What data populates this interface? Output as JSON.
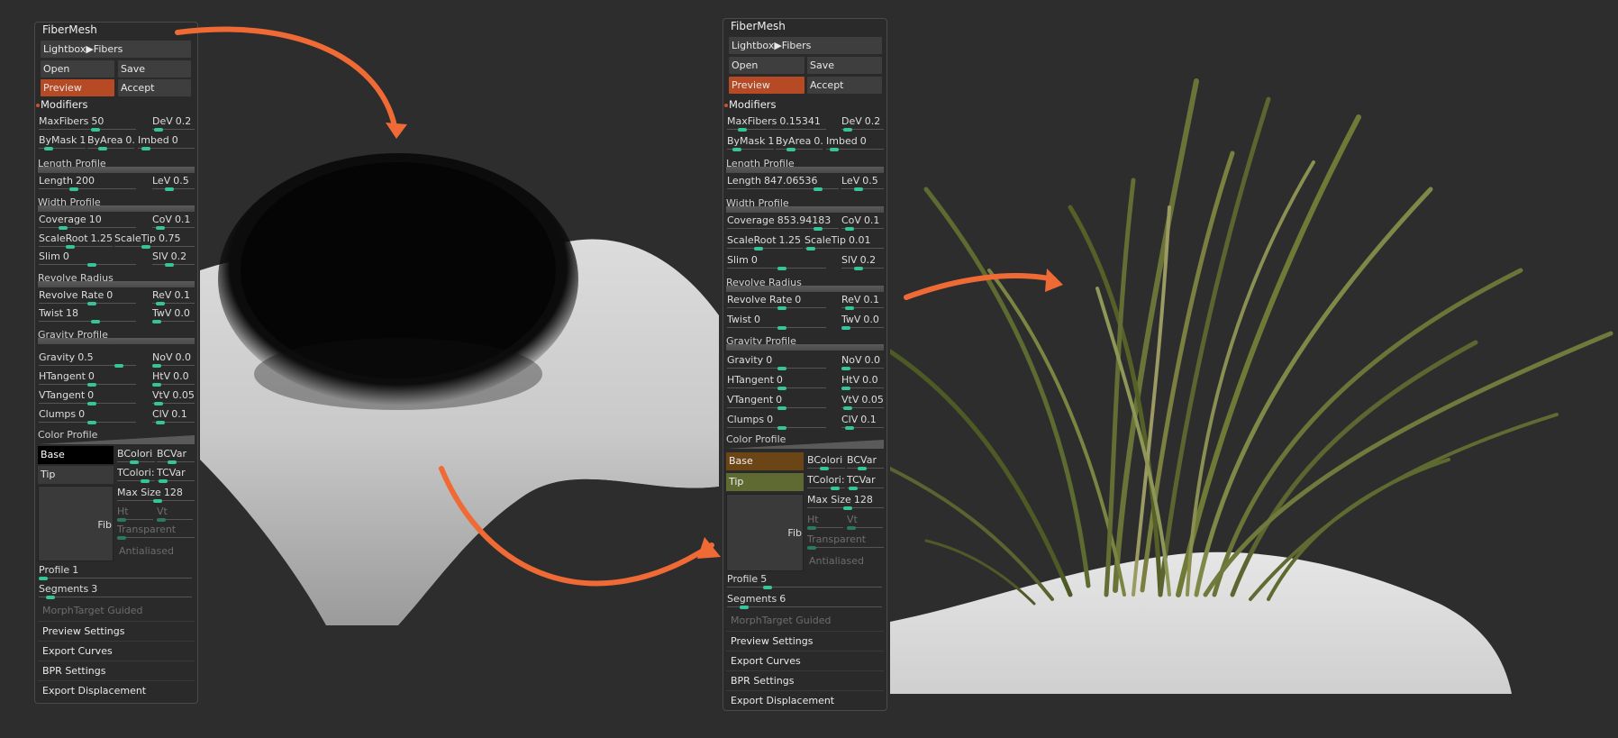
{
  "left_panel": {
    "title": "FiberMesh",
    "lightbox_label": "Lightbox▶Fibers",
    "open_label": "Open",
    "save_label": "Save",
    "preview_label": "Preview",
    "accept_label": "Accept",
    "modifiers_label": "Modifiers",
    "maxfibers": {
      "label": "MaxFibers",
      "value": "50"
    },
    "dev": {
      "label": "DeV",
      "value": "0.2"
    },
    "bymask": {
      "label": "ByMask",
      "value": "1"
    },
    "byarea": {
      "label": "ByArea",
      "value": "0.!"
    },
    "imbed": {
      "label": "Imbed",
      "value": "0"
    },
    "length_profile": "Length Profile",
    "length": {
      "label": "Length",
      "value": "200"
    },
    "lev": {
      "label": "LeV",
      "value": "0.5"
    },
    "width_profile": "Width Profile",
    "coverage": {
      "label": "Coverage",
      "value": "10"
    },
    "cov": {
      "label": "CoV",
      "value": "0.1"
    },
    "scaleroot": {
      "label": "ScaleRoot",
      "value": "1.25"
    },
    "scaletip": {
      "label": "ScaleTip",
      "value": "0.75"
    },
    "slim": {
      "label": "Slim",
      "value": "0"
    },
    "slv": {
      "label": "SlV",
      "value": "0.2"
    },
    "revolve_radius": "Revolve Radius",
    "revolve_rate": {
      "label": "Revolve Rate",
      "value": "0"
    },
    "rev": {
      "label": "ReV",
      "value": "0.1"
    },
    "twist": {
      "label": "Twist",
      "value": "18"
    },
    "twv": {
      "label": "TwV",
      "value": "0.0"
    },
    "gravity_profile": "Gravity Profile",
    "gravity": {
      "label": "Gravity",
      "value": "0.5"
    },
    "nov": {
      "label": "NoV",
      "value": "0.0"
    },
    "htangent": {
      "label": "HTangent",
      "value": "0"
    },
    "htv": {
      "label": "HtV",
      "value": "0.0"
    },
    "vtangent": {
      "label": "VTangent",
      "value": "0"
    },
    "vtv": {
      "label": "VtV",
      "value": "0.05"
    },
    "clumps": {
      "label": "Clumps",
      "value": "0"
    },
    "clv": {
      "label": "ClV",
      "value": "0.1"
    },
    "color_profile": "Color Profile",
    "base_label": "Base",
    "tip_label": "Tip",
    "base_color": "#000000",
    "tip_color": "#3a3a3a",
    "bcolori": "BColori",
    "bcvar": "BCVar",
    "tcolori": "TColori:",
    "tcvar": "TCVar",
    "max_size": {
      "label": "Max Size",
      "value": "128"
    },
    "ht": "Ht",
    "vt": "Vt",
    "transparent": "Transparent",
    "antialiased": "Antialiased",
    "fib": "Fib",
    "profile": {
      "label": "Profile",
      "value": "1"
    },
    "segments": {
      "label": "Segments",
      "value": "3"
    },
    "morphtarget": "MorphTarget Guided",
    "preview_settings": "Preview Settings",
    "export_curves": "Export Curves",
    "bpr_settings": "BPR Settings",
    "export_displacement": "Export Displacement"
  },
  "right_panel": {
    "title": "FiberMesh",
    "lightbox_label": "Lightbox▶Fibers",
    "open_label": "Open",
    "save_label": "Save",
    "preview_label": "Preview",
    "accept_label": "Accept",
    "modifiers_label": "Modifiers",
    "maxfibers": {
      "label": "MaxFibers",
      "value": "0.15341"
    },
    "dev": {
      "label": "DeV",
      "value": "0.2"
    },
    "bymask": {
      "label": "ByMask",
      "value": "1"
    },
    "byarea": {
      "label": "ByArea",
      "value": "0.!"
    },
    "imbed": {
      "label": "Imbed",
      "value": "0"
    },
    "length_profile": "Length Profile",
    "length": {
      "label": "Length",
      "value": "847.06536"
    },
    "lev": {
      "label": "LeV",
      "value": "0.5"
    },
    "width_profile": "Width Profile",
    "coverage": {
      "label": "Coverage",
      "value": "853.94183"
    },
    "cov": {
      "label": "CoV",
      "value": "0.1"
    },
    "scaleroot": {
      "label": "ScaleRoot",
      "value": "1.25"
    },
    "scaletip": {
      "label": "ScaleTip",
      "value": "0.01"
    },
    "slim": {
      "label": "Slim",
      "value": "0"
    },
    "slv": {
      "label": "SlV",
      "value": "0.2"
    },
    "revolve_radius": "Revolve Radius",
    "revolve_rate": {
      "label": "Revolve Rate",
      "value": "0"
    },
    "rev": {
      "label": "ReV",
      "value": "0.1"
    },
    "twist": {
      "label": "Twist",
      "value": "0"
    },
    "twv": {
      "label": "TwV",
      "value": "0.0"
    },
    "gravity_profile": "Gravity Profile",
    "gravity": {
      "label": "Gravity",
      "value": "0"
    },
    "nov": {
      "label": "NoV",
      "value": "0.0"
    },
    "htangent": {
      "label": "HTangent",
      "value": "0"
    },
    "htv": {
      "label": "HtV",
      "value": "0.0"
    },
    "vtangent": {
      "label": "VTangent",
      "value": "0"
    },
    "vtv": {
      "label": "VtV",
      "value": "0.05"
    },
    "clumps": {
      "label": "Clumps",
      "value": "0"
    },
    "clv": {
      "label": "ClV",
      "value": "0.1"
    },
    "color_profile": "Color Profile",
    "base_label": "Base",
    "tip_label": "Tip",
    "base_color": "#6b4515",
    "tip_color": "#5e6a32",
    "bcolori": "BColori",
    "bcvar": "BCVar",
    "tcolori": "TColori:",
    "tcvar": "TCVar",
    "max_size": {
      "label": "Max Size",
      "value": "128"
    },
    "ht": "Ht",
    "vt": "Vt",
    "transparent": "Transparent",
    "antialiased": "Antialiased",
    "fib": "Fib",
    "profile": {
      "label": "Profile",
      "value": "5"
    },
    "segments": {
      "label": "Segments",
      "value": "6"
    },
    "morphtarget": "MorphTarget Guided",
    "preview_settings": "Preview Settings",
    "export_curves": "Export Curves",
    "bpr_settings": "BPR Settings",
    "export_displacement": "Export Displacement"
  },
  "colors": {
    "accent": "#b54a24",
    "arrow": "#f06a36",
    "slider_knob": "#36c49a",
    "background": "#2d2d2d"
  }
}
